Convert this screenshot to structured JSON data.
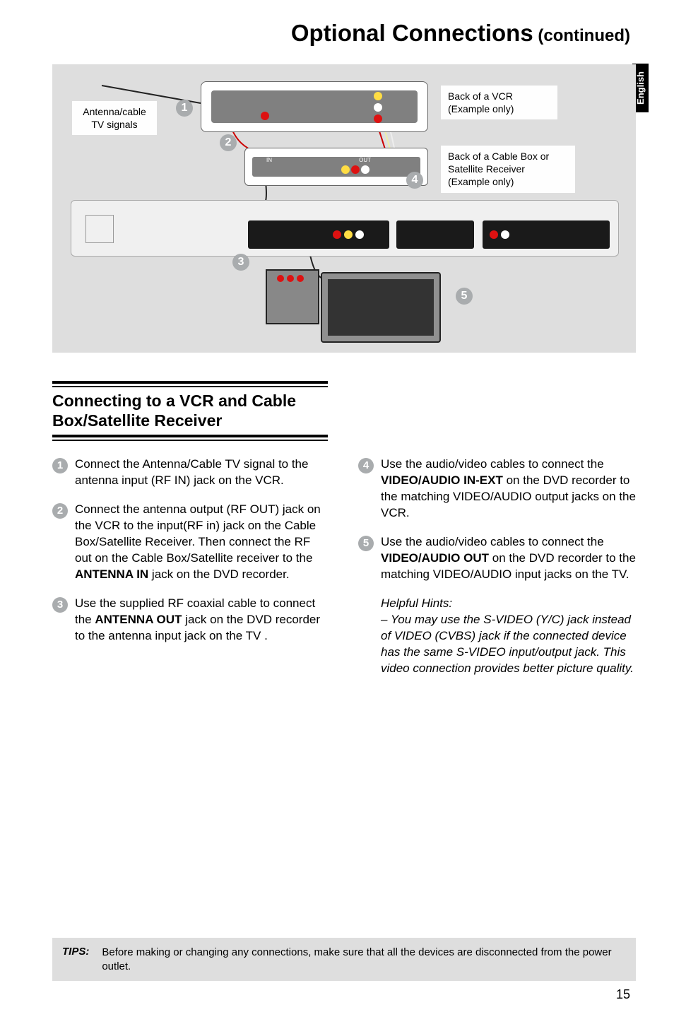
{
  "title": {
    "main": "Optional Connections",
    "cont": " (continued)"
  },
  "sideTab": "English",
  "diagram": {
    "antennaLabel": "Antenna/cable TV signals",
    "vcrLabel": "Back of a VCR (Example only)",
    "satLabel": "Back of a Cable Box or Satellite Receiver (Example only)",
    "bubbles": [
      "1",
      "2",
      "3",
      "4",
      "5"
    ],
    "panelText": {
      "in": "IN",
      "out": "OUT"
    }
  },
  "heading": "Connecting to a VCR and Cable Box/Satellite Receiver",
  "steps": {
    "1": {
      "pre": "Connect the Antenna/Cable TV signal to the antenna input (RF IN) jack on the VCR."
    },
    "2": {
      "pre": "Connect the antenna output (RF OUT) jack on the VCR to the input(RF in) jack on the Cable Box/Satellite Receiver. Then connect the RF out on the Cable Box/Satellite receiver to the ",
      "bold": "ANTENNA IN",
      "post": " jack on the DVD recorder."
    },
    "3": {
      "pre": "Use the supplied RF coaxial cable to connect the ",
      "bold": "ANTENNA OUT",
      "post": " jack on the DVD recorder to the antenna input jack on the TV  ."
    },
    "4": {
      "pre": "Use the audio/video cables to connect the ",
      "bold": "VIDEO/AUDIO IN-EXT",
      "post": " on the DVD recorder to the matching VIDEO/AUDIO output jacks on the VCR."
    },
    "5": {
      "pre": "Use the audio/video cables to connect the ",
      "bold": "VIDEO/AUDIO OUT",
      "post": " on the DVD recorder to the matching VIDEO/AUDIO input jacks on the TV."
    }
  },
  "hints": {
    "title": "Helpful Hints:",
    "line": "– You may use the S-VIDEO (Y/C) jack instead of VIDEO (CVBS) jack if the connected device has the same S-VIDEO input/output jack. This video connection provides better picture quality."
  },
  "tips": {
    "label": "TIPS:",
    "text": "Before making or changing any connections, make sure that all the devices are disconnected from the power outlet."
  },
  "pageNumber": "15"
}
